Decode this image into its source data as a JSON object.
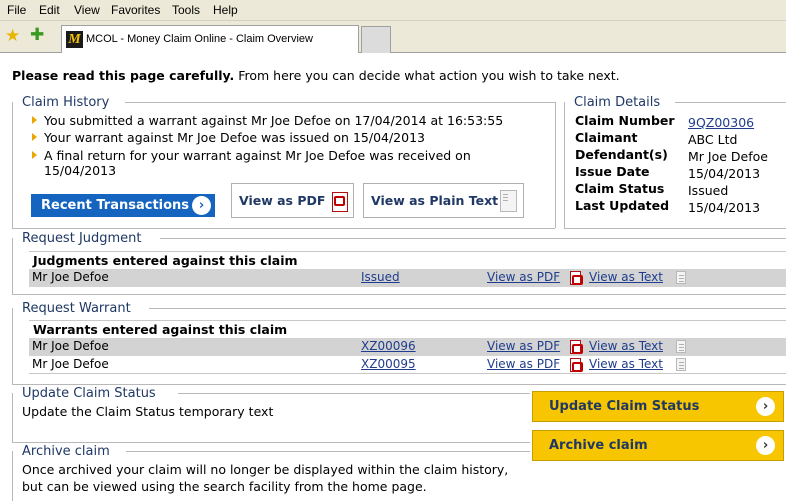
{
  "menu": [
    "File",
    "Edit",
    "View",
    "Favorites",
    "Tools",
    "Help"
  ],
  "browser": {
    "tab_logo": "M",
    "tab_title": "MCOL - Money Claim Online - Claim Overview",
    "favorites_icon": "star-icon",
    "add_favorite_icon": "add-favorite-icon"
  },
  "intro": {
    "bold": "Please read this page carefully.",
    "rest": " From here you can decide what action you wish to take next."
  },
  "claim_history": {
    "title": "Claim History",
    "items": [
      "You submitted a warrant against Mr Joe Defoe on 17/04/2014 at 16:53:55",
      "Your warrant against Mr Joe Defoe was issued on 15/04/2013",
      "A final return for your warrant against Mr Joe Defoe was received on",
      "15/04/2013"
    ],
    "recent_button": "Recent Transactions",
    "view_pdf": "View as PDF",
    "view_text": "View as Plain Text"
  },
  "claim_details": {
    "title": "Claim Details",
    "fields": [
      {
        "label": "Claim Number",
        "value": "9QZ00306"
      },
      {
        "label": "Claimant",
        "value": "ABC Ltd"
      },
      {
        "label": "Defendant(s)",
        "value": "Mr Joe Defoe"
      },
      {
        "label": "Issue Date",
        "value": "15/04/2013"
      },
      {
        "label": "Claim Status",
        "value": "Issued"
      },
      {
        "label": "Last Updated",
        "value": "15/04/2013"
      }
    ]
  },
  "judgment": {
    "title": "Request Judgment",
    "table_title": "Judgments entered against this claim",
    "rows": [
      {
        "name": "Mr Joe Defoe",
        "ref": "Issued",
        "pdf": "View as PDF",
        "text": "View as Text"
      }
    ]
  },
  "warrant": {
    "title": "Request Warrant",
    "table_title": "Warrants entered against this claim",
    "rows": [
      {
        "name": "Mr Joe Defoe",
        "ref": "XZ00096",
        "pdf": "View as PDF",
        "text": "View as Text"
      },
      {
        "name": "Mr Joe Defoe",
        "ref": "XZ00095",
        "pdf": "View as PDF",
        "text": "View as Text"
      }
    ]
  },
  "update_status": {
    "title": "Update Claim Status",
    "text": "Update the Claim Status temporary text",
    "button": "Update Claim Status"
  },
  "archive": {
    "title": "Archive claim",
    "text_line1": "Once archived your claim will no longer be displayed within the claim history,",
    "text_line2": "but can be viewed using the search facility from the home page.",
    "button": "Archive claim"
  },
  "colors": {
    "accent_blue": "#1565c0",
    "accent_yellow": "#f7c600",
    "heading": "#1f3864",
    "bullet": "#e8a700"
  }
}
